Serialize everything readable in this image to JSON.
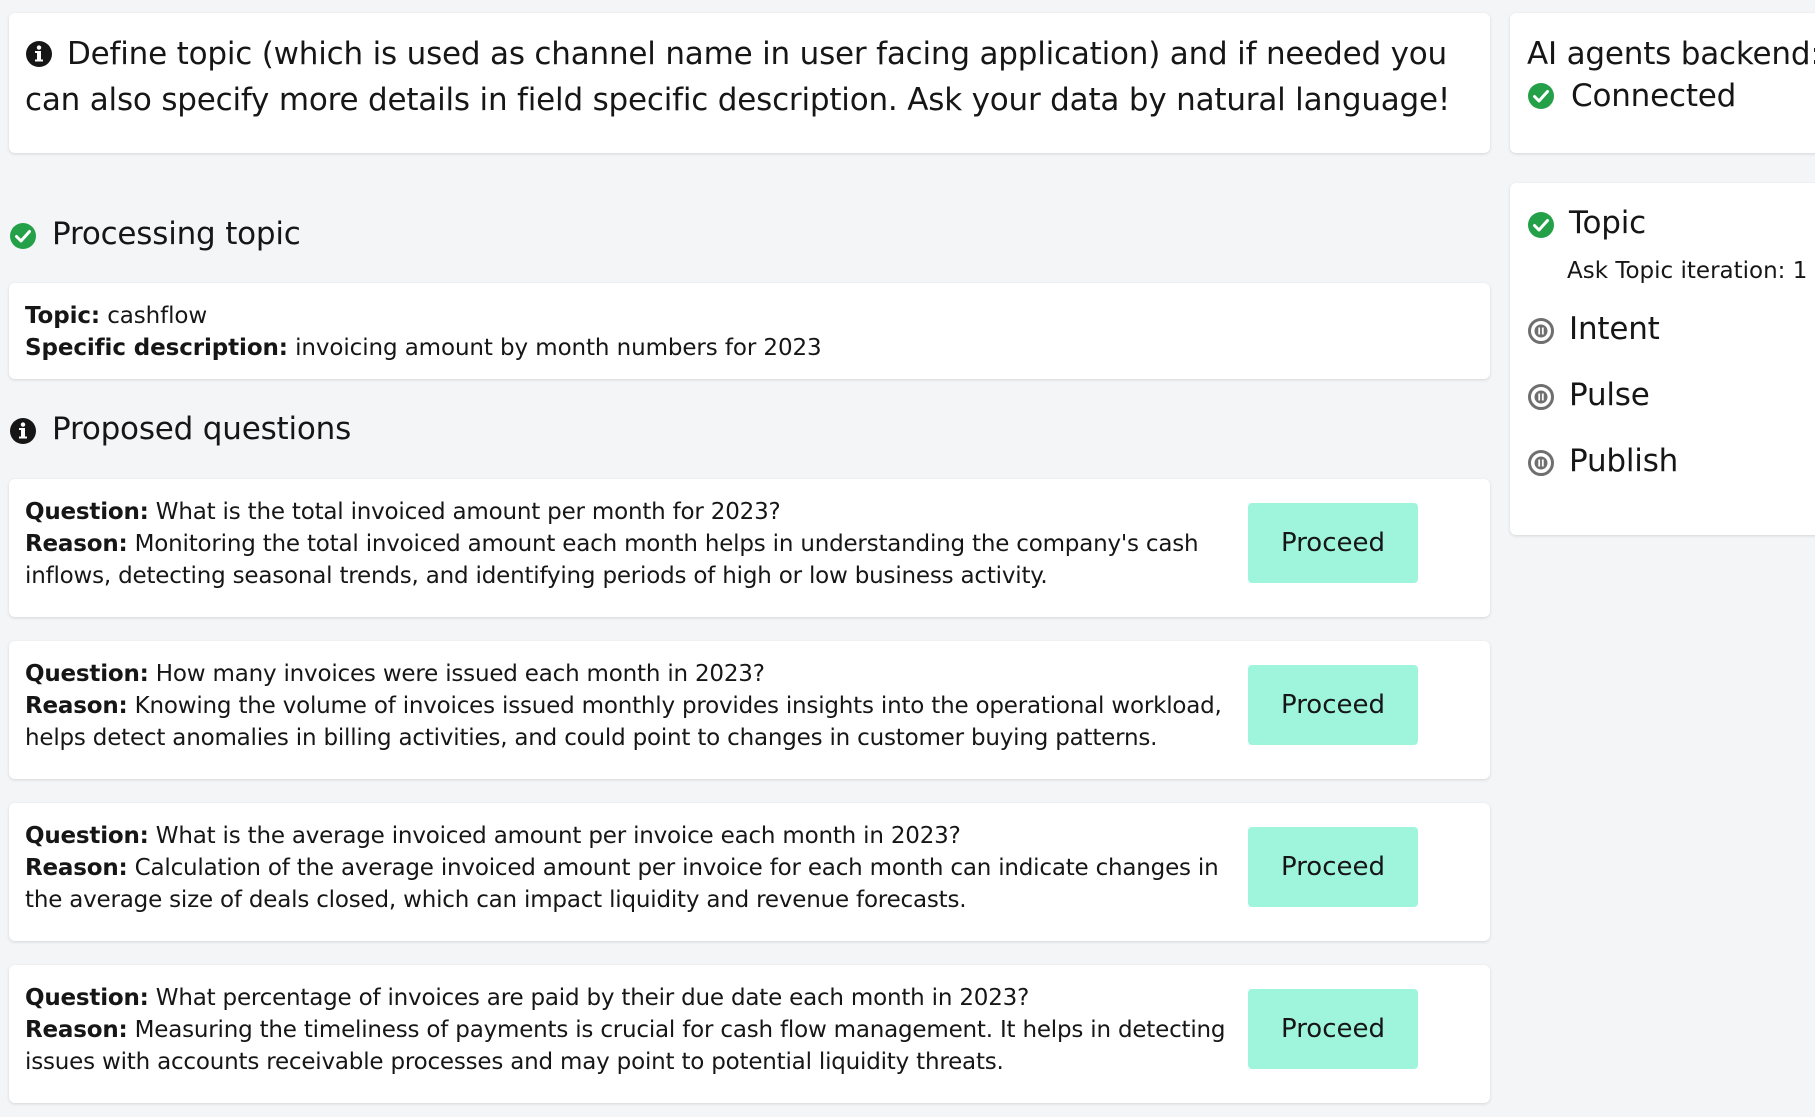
{
  "info_banner": {
    "text": "Define topic (which is used as channel name in user facing application) and if needed you can also specify more details in field specific description. Ask your data by natural language!"
  },
  "backend_status": {
    "label": "AI agents backend:",
    "status": "Connected"
  },
  "processing": {
    "heading": "Processing topic",
    "topic_label": "Topic:",
    "topic_value": "cashflow",
    "description_label": "Specific description:",
    "description_value": "invoicing amount by month numbers for 2023"
  },
  "proposed": {
    "heading": "Proposed questions",
    "question_label": "Question:",
    "reason_label": "Reason:",
    "button_label": "Proceed",
    "items": [
      {
        "question": "What is the total invoiced amount per month for 2023?",
        "reason": "Monitoring the total invoiced amount each month helps in understanding the company's cash inflows, detecting seasonal trends, and identifying periods of high or low business activity."
      },
      {
        "question": "How many invoices were issued each month in 2023?",
        "reason": "Knowing the volume of invoices issued monthly provides insights into the operational workload, helps detect anomalies in billing activities, and could point to changes in customer buying patterns."
      },
      {
        "question": "What is the average invoiced amount per invoice each month in 2023?",
        "reason": "Calculation of the average invoiced amount per invoice for each month can indicate changes in the average size of deals closed, which can impact liquidity and revenue forecasts."
      },
      {
        "question": "What percentage of invoices are paid by their due date each month in 2023?",
        "reason": "Measuring the timeliness of payments is crucial for cash flow management. It helps in detecting issues with accounts receivable processes and may point to potential liquidity threats."
      }
    ]
  },
  "steps": {
    "topic": {
      "label": "Topic",
      "state": "done",
      "detail": "Ask Topic iteration: 1"
    },
    "intent": {
      "label": "Intent",
      "state": "paused"
    },
    "pulse": {
      "label": "Pulse",
      "state": "paused"
    },
    "publish": {
      "label": "Publish",
      "state": "paused"
    }
  },
  "colors": {
    "success": "#24a148",
    "paused": "#6f6f6f",
    "button": "#9ef5dc",
    "background": "#f4f5f7"
  },
  "icons": {
    "info": "info-icon",
    "success": "checkmark-circle-icon",
    "paused": "pause-circle-icon"
  }
}
